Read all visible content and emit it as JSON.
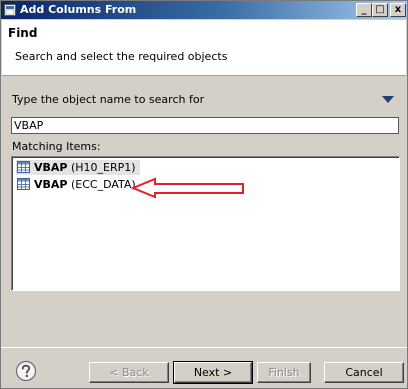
{
  "window": {
    "title": "Add Columns From",
    "minimize_glyph": "_",
    "maximize_glyph": "□",
    "close_glyph": "x"
  },
  "header": {
    "heading": "Find",
    "description": "Search and select the required objects"
  },
  "search": {
    "label": "Type the object name to search for",
    "value": "VBAP"
  },
  "matching": {
    "label": "Matching Items:",
    "items": [
      {
        "name": "VBAP",
        "source": " (H10_ERP1)",
        "selected": true,
        "icon": "table-icon"
      },
      {
        "name": "VBAP",
        "source": " (ECC_DATA)",
        "selected": false,
        "icon": "table-icon"
      }
    ]
  },
  "buttons": {
    "back": "< Back",
    "next": "Next >",
    "finish": "Finish",
    "cancel": "Cancel"
  },
  "colors": {
    "titlebar_start": "#0a246a",
    "annotation_arrow": "#e0202a",
    "dialog_bg": "#d4d0c8"
  }
}
